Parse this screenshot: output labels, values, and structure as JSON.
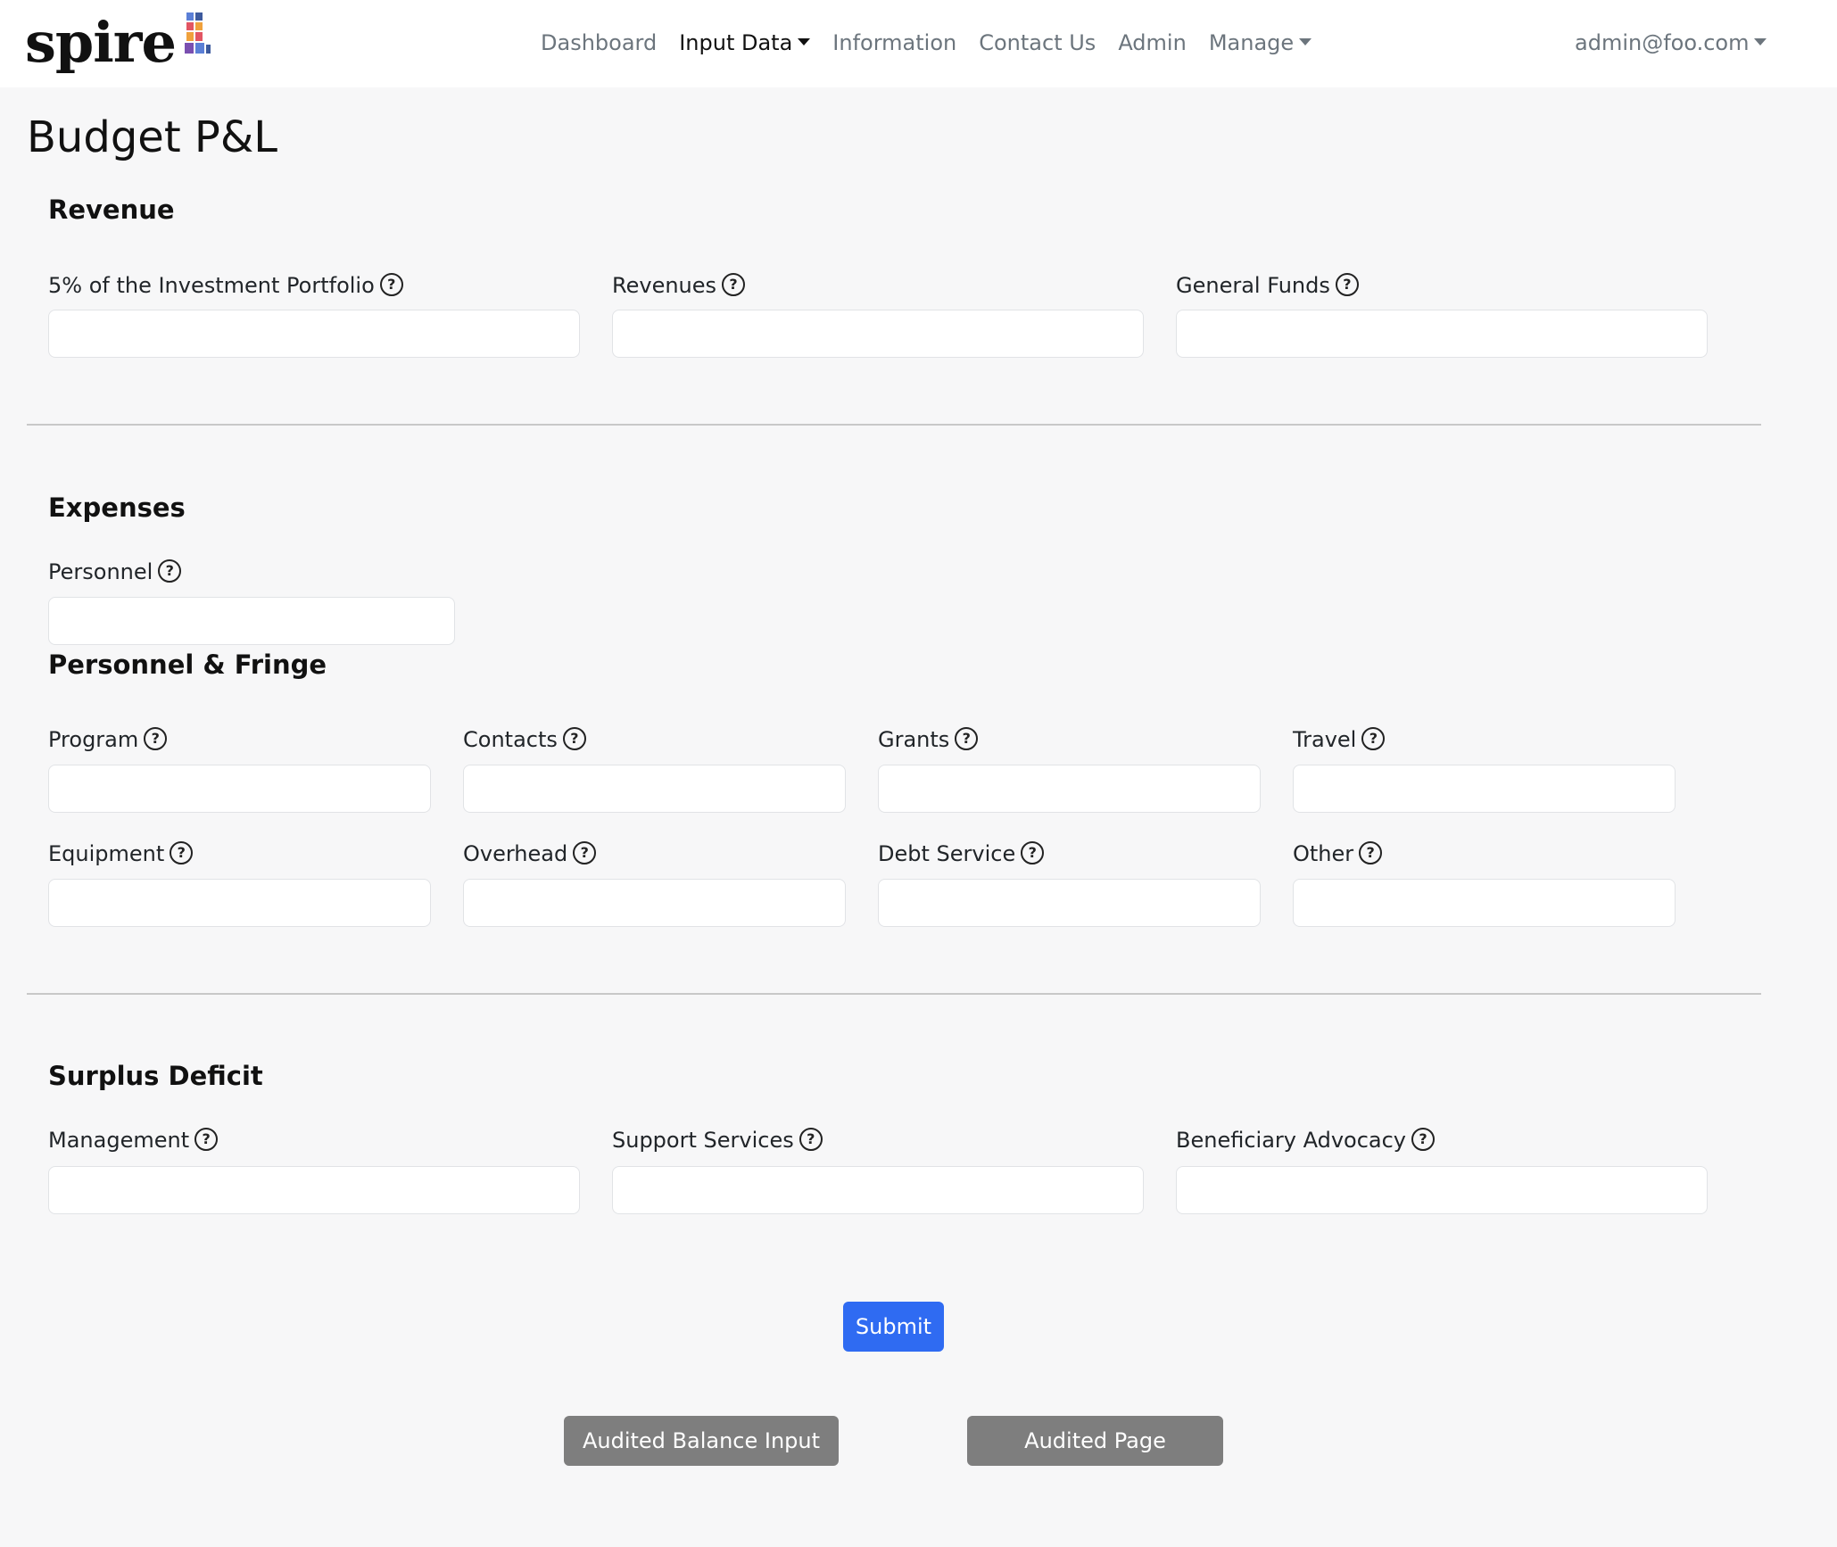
{
  "brand": {
    "name": "spire"
  },
  "nav": {
    "items": [
      {
        "label": "Dashboard"
      },
      {
        "label": "Input Data"
      },
      {
        "label": "Information"
      },
      {
        "label": "Contact Us"
      },
      {
        "label": "Admin"
      },
      {
        "label": "Manage"
      }
    ],
    "user": "admin@foo.com"
  },
  "page": {
    "title": "Budget P&L"
  },
  "revenue": {
    "title": "Revenue",
    "fields": [
      {
        "label": "5% of the Investment Portfolio",
        "value": ""
      },
      {
        "label": "Revenues",
        "value": ""
      },
      {
        "label": "General Funds",
        "value": ""
      }
    ]
  },
  "expenses": {
    "title": "Expenses",
    "personnel": {
      "label": "Personnel",
      "value": ""
    },
    "subsection_title": "Personnel & Fringe",
    "fields": [
      {
        "label": "Program",
        "value": ""
      },
      {
        "label": "Contacts",
        "value": ""
      },
      {
        "label": "Grants",
        "value": ""
      },
      {
        "label": "Travel",
        "value": ""
      },
      {
        "label": "Equipment",
        "value": ""
      },
      {
        "label": "Overhead",
        "value": ""
      },
      {
        "label": "Debt Service",
        "value": ""
      },
      {
        "label": "Other",
        "value": ""
      }
    ]
  },
  "surplus": {
    "title": "Surplus Deficit",
    "fields": [
      {
        "label": "Management",
        "value": ""
      },
      {
        "label": "Support Services",
        "value": ""
      },
      {
        "label": "Beneficiary Advocacy",
        "value": ""
      }
    ]
  },
  "actions": {
    "submit": "Submit",
    "audited_balance": "Audited Balance Input",
    "audited_page": "Audited Page"
  },
  "help_glyph": "?",
  "colors": {
    "primary": "#2f6bf2",
    "secondary": "#7e7e7e",
    "background": "#f7f7f8",
    "logo_squares": [
      "#5b7fd6",
      "#e25563",
      "#f0a13c",
      "#7a4fb0",
      "#3d5a9e"
    ]
  }
}
